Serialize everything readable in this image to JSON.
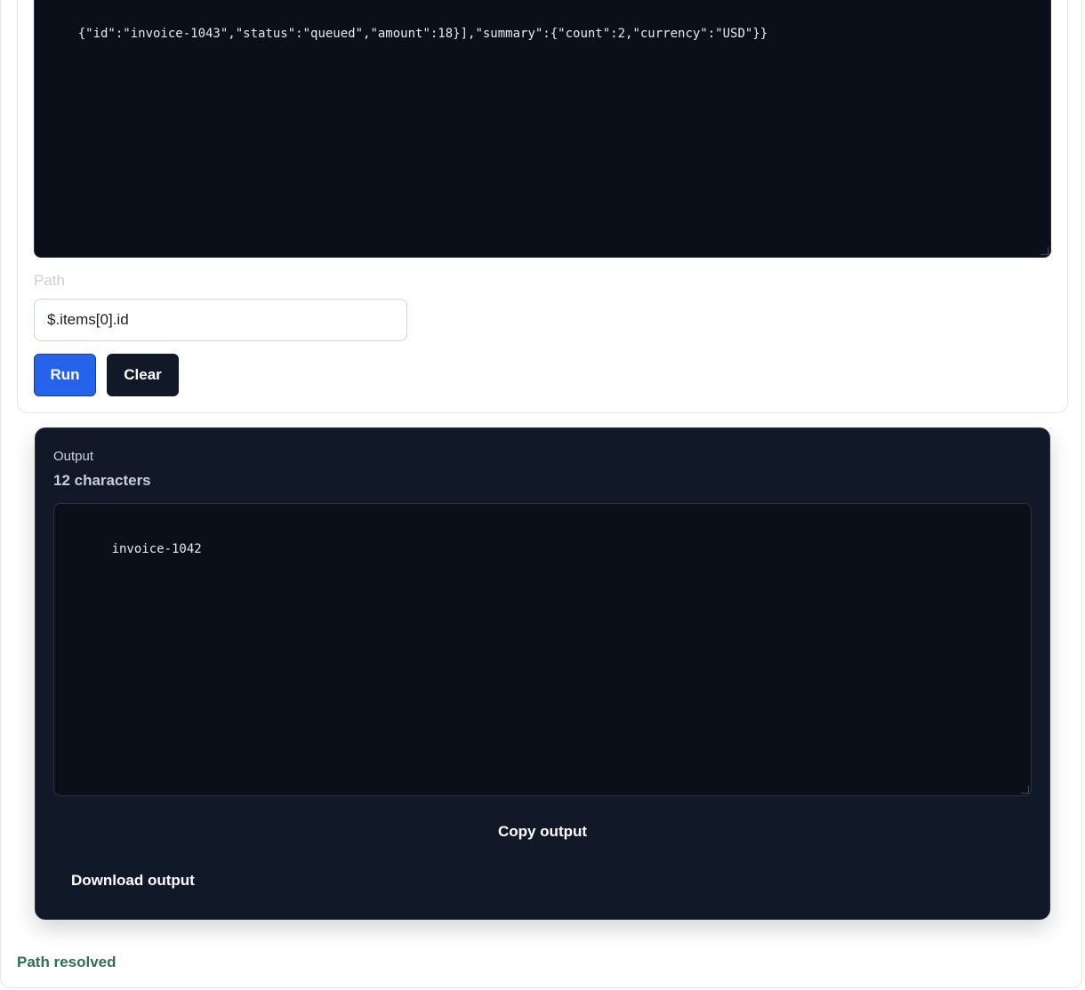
{
  "input": {
    "json_text": "{\"id\":\"invoice-1043\",\"status\":\"queued\",\"amount\":18}],\"summary\":{\"count\":2,\"currency\":\"USD\"}}",
    "path_label": "Path",
    "path_value": "$.items[0].id",
    "run_label": "Run",
    "clear_label": "Clear"
  },
  "output": {
    "label": "Output",
    "count_text": "12 characters",
    "value": "invoice-1042",
    "copy_label": "Copy output",
    "download_label": "Download output"
  },
  "status": {
    "message": "Path resolved"
  },
  "colors": {
    "run_button": "#2563eb",
    "dark_button": "#111827",
    "output_panel": "#111827",
    "textarea_bg": "#0b0f19",
    "status_success": "#2f6f54"
  }
}
